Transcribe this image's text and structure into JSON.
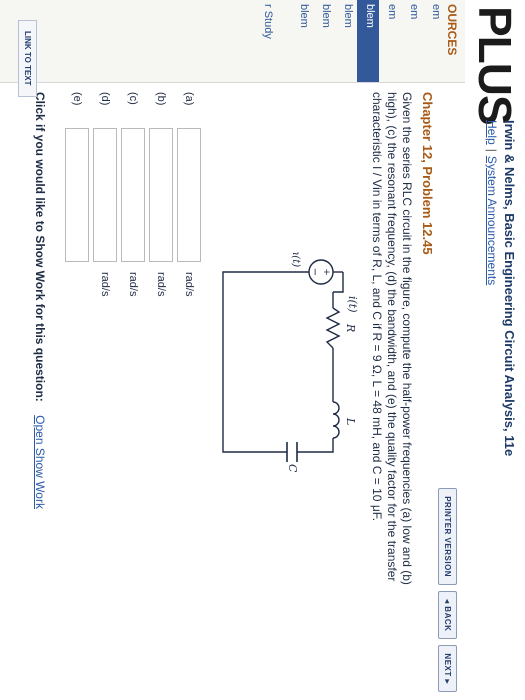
{
  "header": {
    "brand": "PLUS",
    "book_title": "Irwin & Nelms, Basic Engineering Circuit Analysis, 11e",
    "help_link": "Help",
    "separator": "|",
    "announcements_link": "System Announcements"
  },
  "sidebar": {
    "heading": "OURCES",
    "items": [
      {
        "label": "em",
        "highlighted": false
      },
      {
        "label": "em",
        "highlighted": false
      },
      {
        "label": "em",
        "highlighted": false
      },
      {
        "label": "blem",
        "highlighted": true
      },
      {
        "label": "blem",
        "highlighted": false
      },
      {
        "label": "blem",
        "highlighted": false
      },
      {
        "label": "blem",
        "highlighted": false
      },
      {
        "label": "r Study",
        "highlighted": false
      }
    ]
  },
  "toolbar": {
    "printer_version": "PRINTER VERSION",
    "back": "◂ BACK",
    "next": "NEXT ▸"
  },
  "problem": {
    "title": "Chapter 12, Problem 12.45",
    "text_line1": "Given the series RLC circuit in the figure, compute the half-power frequencies (a) low and (b)",
    "text_line2": "high), (c) the resonant frequency, (d) the bandwidth, and (e) the quality factor for the transfer",
    "text_line3": "characteristic I / Vin in terms of R, L, and C if R = 9 Ω, L = 48 mH, and C = 10 μF."
  },
  "circuit": {
    "current_label": "i(t)",
    "r_label": "R",
    "l_label": "L",
    "c_label": "C",
    "source_label": "vin(t)",
    "plus": "+",
    "minus": "−"
  },
  "answers": [
    {
      "label": "(a)",
      "value": "",
      "unit": "rad/s"
    },
    {
      "label": "(b)",
      "value": "",
      "unit": "rad/s"
    },
    {
      "label": "(c)",
      "value": "",
      "unit": "rad/s"
    },
    {
      "label": "(d)",
      "value": "",
      "unit": "rad/s"
    },
    {
      "label": "(e)",
      "value": "",
      "unit": ""
    }
  ],
  "show_work": {
    "prompt": "Click if you would like to Show Work for this question:",
    "link": "Open Show Work"
  },
  "footer": {
    "link_to_text": "LINK TO TEXT"
  },
  "colors": {
    "accent_orange": "#a85a16",
    "link_blue": "#2a5aa8",
    "nav_highlight": "#33599b"
  }
}
